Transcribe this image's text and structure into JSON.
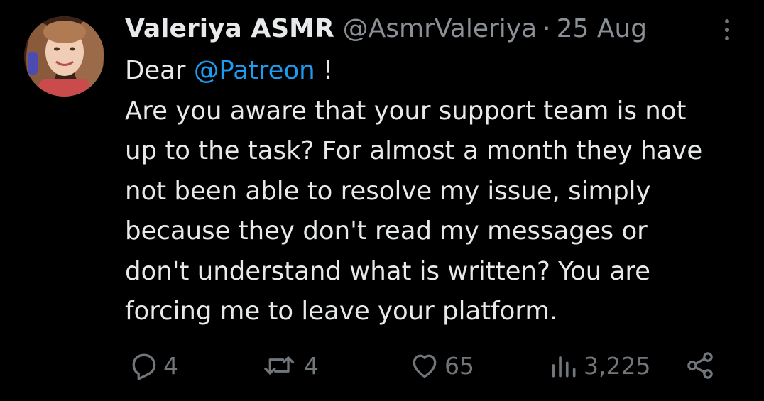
{
  "author": {
    "name": "Valeriya ASMR",
    "handle": "@AsmrValeriya",
    "separator": "·",
    "date": "25 Aug"
  },
  "tweet": {
    "greeting_prefix": "Dear ",
    "mention": "@Patreon",
    "greeting_suffix": " !",
    "lines": [
      "Are you aware that your support team is not",
      "up to the task? For almost a month they have",
      "not been able to resolve my issue, simply",
      "because they don't read my messages or",
      "don't understand what is written? You are",
      "forcing me to leave your platform."
    ]
  },
  "actions": {
    "replies": "4",
    "reposts": "4",
    "likes": "65",
    "views": "3,225"
  },
  "icons": {
    "reply": "reply-icon",
    "repost": "repost-icon",
    "like": "heart-icon",
    "views": "views-icon",
    "share": "share-icon",
    "more": "more-options-icon"
  },
  "colors": {
    "background": "#000000",
    "text": "#e7e9ea",
    "secondary": "#71767b",
    "mention": "#1d9bf0"
  }
}
